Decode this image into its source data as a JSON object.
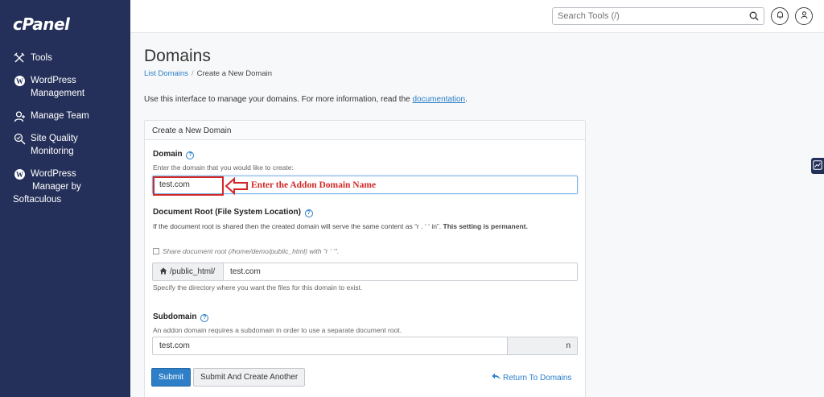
{
  "brand": {
    "logo": "cPanel"
  },
  "sidebar": {
    "items": [
      {
        "label": "Tools",
        "icon": "tools-icon"
      },
      {
        "label": "WordPress Management",
        "line1": "WordPress",
        "line2": "Management",
        "icon": "wordpress-icon"
      },
      {
        "label": "Manage Team",
        "icon": "team-icon"
      },
      {
        "label": "Site Quality Monitoring",
        "line1": "Site Quality",
        "line2": "Monitoring",
        "icon": "search-quality-icon"
      },
      {
        "label": "WordPress Manager by Softaculous",
        "line1": "WordPress",
        "line2": "Manager by",
        "line3": "Softaculous",
        "icon": "wordpress-icon"
      }
    ]
  },
  "header": {
    "search_placeholder": "Search Tools (/)"
  },
  "page": {
    "title": "Domains",
    "breadcrumb": {
      "link": "List Domains",
      "separator": "/",
      "current": "Create a New Domain"
    },
    "intro_text": "Use this interface to manage your domains. For more information, read the ",
    "intro_link": "documentation",
    "intro_end": "."
  },
  "form": {
    "panel_title": "Create a New Domain",
    "domain": {
      "label": "Domain",
      "hint": "Enter the domain that you would like to create:",
      "value": "test.com"
    },
    "annotation": "Enter the Addon Domain Name",
    "docroot": {
      "label": "Document Root (File System Location)",
      "desc_start": "If the document root is shared then the created domain will serve the same content as “r",
      "desc_mid": "   .   ‘  ‘ in”. ",
      "desc_bold": "This setting is permanent.",
      "checkbox_label": "Share document root (/home/demo/public_html) with “r                   ‘     ‘”.",
      "prefix": "/public_html/",
      "value": "test.com",
      "help": "Specify the directory where you want the files for this domain to exist."
    },
    "subdomain": {
      "label": "Subdomain",
      "hint": "An addon domain requires a subdomain in order to use a separate document root.",
      "value": "test.com",
      "suffix": "n"
    },
    "buttons": {
      "submit": "Submit",
      "submit_another": "Submit And Create Another",
      "return": "Return To Domains"
    }
  },
  "colors": {
    "sidebar_bg": "#25305a",
    "primary": "#2e7fc7",
    "link": "#2a7ec8",
    "annotation": "#d32727"
  }
}
